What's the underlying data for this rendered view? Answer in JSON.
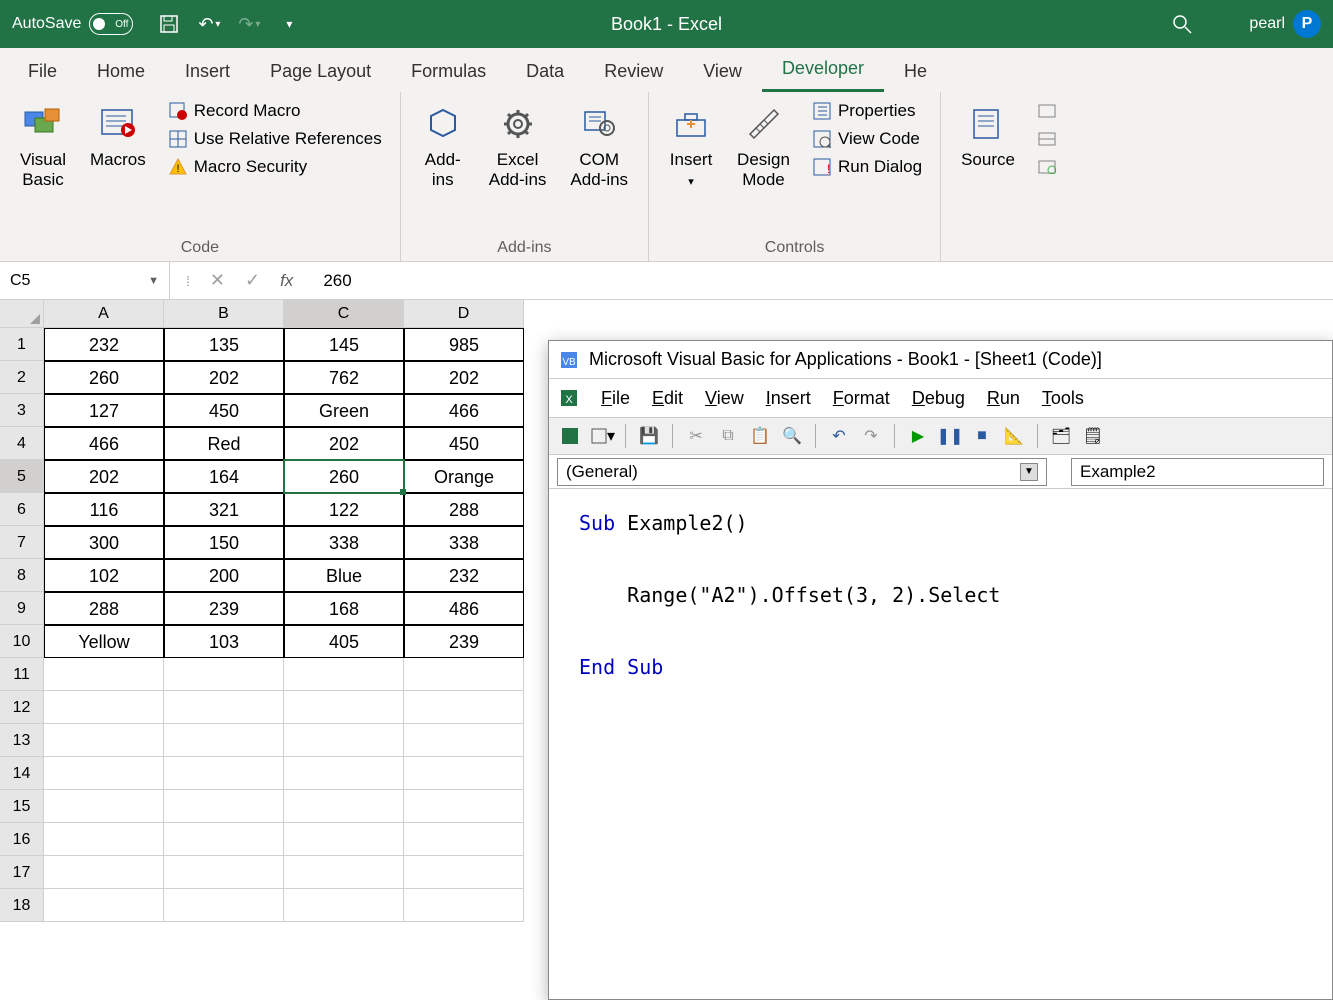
{
  "titlebar": {
    "autosave_label": "AutoSave",
    "autosave_state": "Off",
    "title": "Book1 - Excel",
    "user_name": "pearl",
    "user_initial": "P"
  },
  "menu": {
    "tabs": [
      "File",
      "Home",
      "Insert",
      "Page Layout",
      "Formulas",
      "Data",
      "Review",
      "View",
      "Developer",
      "He"
    ],
    "active_index": 8
  },
  "ribbon": {
    "code": {
      "label": "Code",
      "visual_basic": "Visual\nBasic",
      "macros": "Macros",
      "record_macro": "Record Macro",
      "use_relative": "Use Relative References",
      "macro_security": "Macro Security"
    },
    "addins": {
      "label": "Add-ins",
      "add_ins": "Add-\nins",
      "excel_addins": "Excel\nAdd-ins",
      "com_addins": "COM\nAdd-ins"
    },
    "controls": {
      "label": "Controls",
      "insert": "Insert",
      "design_mode": "Design\nMode",
      "properties": "Properties",
      "view_code": "View Code",
      "run_dialog": "Run Dialog"
    },
    "xml": {
      "source": "Source"
    }
  },
  "formula_bar": {
    "name_box": "C5",
    "value": "260"
  },
  "sheet": {
    "columns": [
      "A",
      "B",
      "C",
      "D"
    ],
    "active_col_index": 2,
    "active_row_index": 4,
    "rows": [
      {
        "n": "1",
        "cells": [
          "232",
          "135",
          "145",
          "985"
        ]
      },
      {
        "n": "2",
        "cells": [
          "260",
          "202",
          "762",
          "202"
        ]
      },
      {
        "n": "3",
        "cells": [
          "127",
          "450",
          "Green",
          "466"
        ]
      },
      {
        "n": "4",
        "cells": [
          "466",
          "Red",
          "202",
          "450"
        ]
      },
      {
        "n": "5",
        "cells": [
          "202",
          "164",
          "260",
          "Orange"
        ]
      },
      {
        "n": "6",
        "cells": [
          "116",
          "321",
          "122",
          "288"
        ]
      },
      {
        "n": "7",
        "cells": [
          "300",
          "150",
          "338",
          "338"
        ]
      },
      {
        "n": "8",
        "cells": [
          "102",
          "200",
          "Blue",
          "232"
        ]
      },
      {
        "n": "9",
        "cells": [
          "288",
          "239",
          "168",
          "486"
        ]
      },
      {
        "n": "10",
        "cells": [
          "Yellow",
          "103",
          "405",
          "239"
        ]
      },
      {
        "n": "11",
        "cells": [
          "",
          "",
          "",
          ""
        ]
      },
      {
        "n": "12",
        "cells": [
          "",
          "",
          "",
          ""
        ]
      },
      {
        "n": "13",
        "cells": [
          "",
          "",
          "",
          ""
        ]
      },
      {
        "n": "14",
        "cells": [
          "",
          "",
          "",
          ""
        ]
      },
      {
        "n": "15",
        "cells": [
          "",
          "",
          "",
          ""
        ]
      },
      {
        "n": "16",
        "cells": [
          "",
          "",
          "",
          ""
        ]
      },
      {
        "n": "17",
        "cells": [
          "",
          "",
          "",
          ""
        ]
      },
      {
        "n": "18",
        "cells": [
          "",
          "",
          "",
          ""
        ]
      }
    ],
    "selected": {
      "row": 4,
      "col": 2
    }
  },
  "vba": {
    "title": "Microsoft Visual Basic for Applications - Book1 - [Sheet1 (Code)]",
    "menus": [
      "File",
      "Edit",
      "View",
      "Insert",
      "Format",
      "Debug",
      "Run",
      "Tools"
    ],
    "combo_left": "(General)",
    "combo_right": "Example2",
    "code_lines": [
      {
        "t": "kw",
        "s": "Sub "
      },
      {
        "t": "",
        "s": "Example2()"
      },
      {
        "t": "br"
      },
      {
        "t": "br"
      },
      {
        "t": "",
        "s": "    Range(\"A2\").Offset(3, 2).Select"
      },
      {
        "t": "br"
      },
      {
        "t": "br"
      },
      {
        "t": "kw",
        "s": "End Sub"
      }
    ]
  }
}
